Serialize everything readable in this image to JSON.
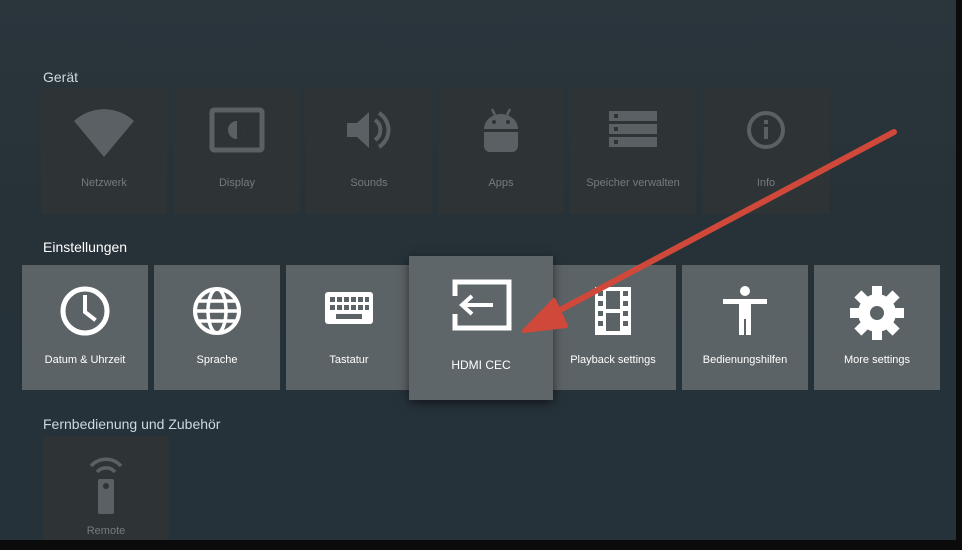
{
  "sections": {
    "device": {
      "title": "Gerät",
      "items": [
        "Netzwerk",
        "Display",
        "Sounds",
        "Apps",
        "Speicher verwalten",
        "Info"
      ]
    },
    "settings": {
      "title": "Einstellungen",
      "items": [
        "Datum & Uhrzeit",
        "Sprache",
        "Tastatur",
        "HDMI CEC",
        "Playback settings",
        "Bedienungshilfen",
        "More settings"
      ]
    },
    "remote": {
      "title": "Fernbedienung und Zubehör",
      "items": [
        "Remote"
      ]
    }
  },
  "icons": {
    "device": [
      "wifi-icon",
      "display-icon",
      "speaker-icon",
      "android-icon",
      "storage-icon",
      "info-icon"
    ],
    "settings": [
      "clock-icon",
      "globe-icon",
      "keyboard-icon",
      "input-icon",
      "film-icon",
      "accessibility-icon",
      "gear-icon"
    ],
    "remote": [
      "remote-icon"
    ]
  },
  "colors": {
    "background": "#263238",
    "tile_dim": "#2e3436",
    "tile_active": "#5c6366",
    "annotation_arrow": "#d0483a"
  }
}
